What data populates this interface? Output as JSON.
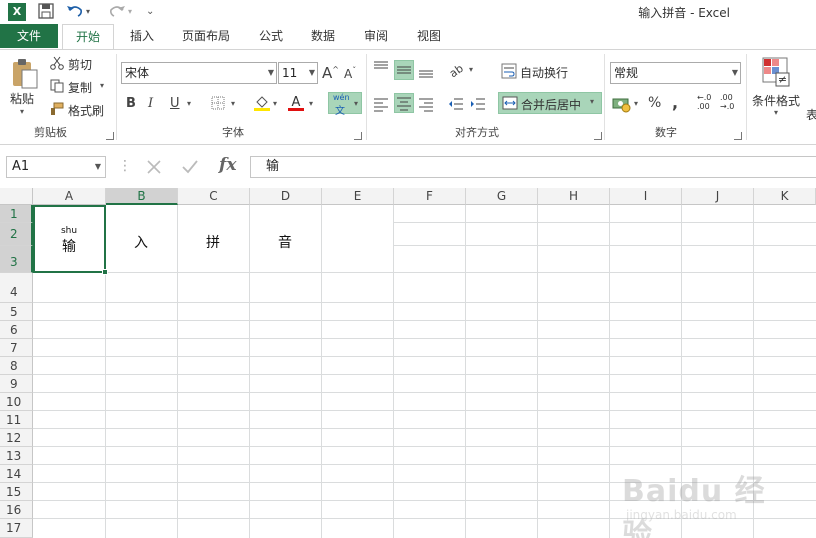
{
  "window": {
    "title": "输入拼音 - Excel",
    "logo_letter": "X"
  },
  "tabs": [
    {
      "label": "文件"
    },
    {
      "label": "开始"
    },
    {
      "label": "插入"
    },
    {
      "label": "页面布局"
    },
    {
      "label": "公式"
    },
    {
      "label": "数据"
    },
    {
      "label": "审阅"
    },
    {
      "label": "视图"
    }
  ],
  "ribbon": {
    "clipboard": {
      "paste": "粘贴",
      "cut": "剪切",
      "copy": "复制",
      "format_painter": "格式刷",
      "label": "剪贴板"
    },
    "font": {
      "name": "宋体",
      "size": "11",
      "bold": "B",
      "italic": "I",
      "underline": "U",
      "pinyin_top": "wén",
      "pinyin_bottom": "文",
      "label": "字体"
    },
    "alignment": {
      "wrap_text": "自动换行",
      "merge_center": "合并后居中",
      "label": "对齐方式"
    },
    "number": {
      "format": "常规",
      "percent": "%",
      "comma": ",",
      "inc_decimal": "←.0 .00",
      "dec_decimal": ".00 →.0",
      "label": "数字"
    },
    "styles": {
      "conditional": "条件格式",
      "table_partial": "表"
    },
    "accent_color": "#217346",
    "highlight_color": "#a9d5b9"
  },
  "formula_bar": {
    "name_box": "A1",
    "fx": "fx",
    "content": "输"
  },
  "grid": {
    "columns": [
      "A",
      "B",
      "C",
      "D",
      "E",
      "F",
      "G",
      "H",
      "I",
      "J",
      "K"
    ],
    "rows": [
      "1",
      "2",
      "3",
      "4",
      "5",
      "6",
      "7",
      "8",
      "9",
      "10",
      "11",
      "12",
      "13",
      "14",
      "15",
      "16",
      "17"
    ],
    "cells": {
      "A_pinyin": "shu",
      "A": "输",
      "B": "入",
      "C": "拼",
      "D": "音"
    }
  },
  "watermark": {
    "logo": "Baidu 经验",
    "url": "jingyan.baidu.com"
  }
}
